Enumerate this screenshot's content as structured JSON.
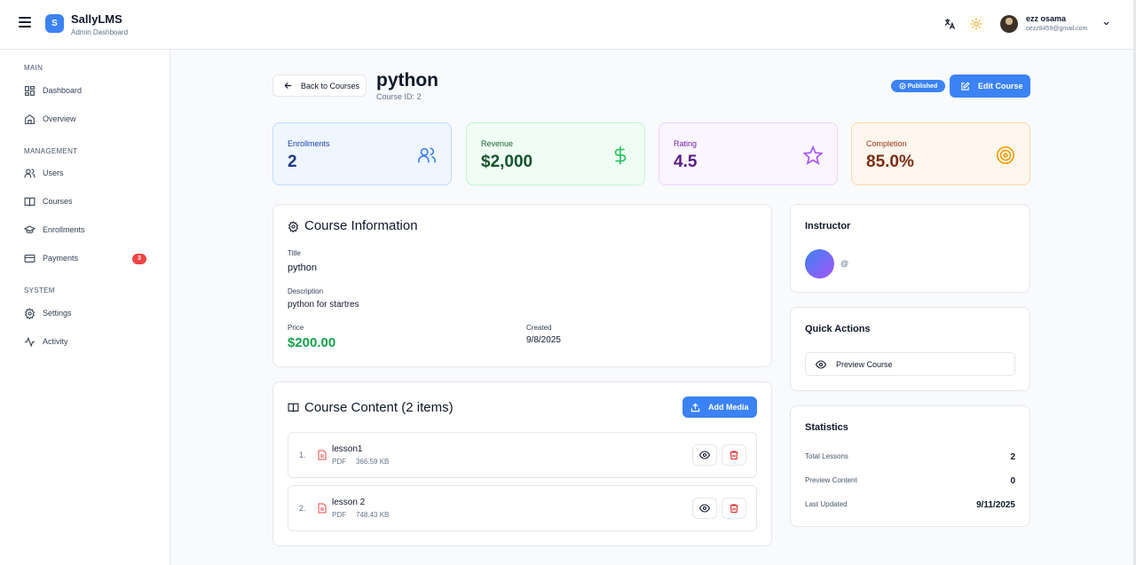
{
  "header": {
    "brand_title": "SallyLMS",
    "brand_sub": "Admin Dashboard",
    "logo_letter": "S",
    "user_name": "ezz osama",
    "user_email": "oezz8459@gmail.com"
  },
  "sidebar": {
    "sections": {
      "main": "MAIN",
      "management": "MANAGEMENT",
      "system": "SYSTEM"
    },
    "items": {
      "dashboard": "Dashboard",
      "overview": "Overview",
      "users": "Users",
      "courses": "Courses",
      "enrollments": "Enrollments",
      "payments": "Payments",
      "settings": "Settings",
      "activity": "Activity"
    },
    "payments_badge": "3"
  },
  "page": {
    "back_label": "Back to Courses",
    "title": "python",
    "course_id": "Course ID: 2",
    "status": "Published",
    "edit_label": "Edit Course"
  },
  "stats": {
    "enrollments": {
      "label": "Enrollments",
      "value": "2"
    },
    "revenue": {
      "label": "Revenue",
      "value": "$2,000"
    },
    "rating": {
      "label": "Rating",
      "value": "4.5"
    },
    "completion": {
      "label": "Completion",
      "value": "85.0%"
    }
  },
  "course_info": {
    "heading": "Course Information",
    "title_label": "Title",
    "title_value": "python",
    "description_label": "Description",
    "description_value": "python for startres",
    "price_label": "Price",
    "price_value": "$200.00",
    "created_label": "Created",
    "created_value": "9/8/2025"
  },
  "content": {
    "heading": "Course Content (2 items)",
    "add_label": "Add Media",
    "lessons": [
      {
        "num": "1.",
        "name": "lesson1",
        "type": "PDF",
        "size": "366.59 KB"
      },
      {
        "num": "2.",
        "name": "lesson 2",
        "type": "PDF",
        "size": "748.43 KB"
      }
    ]
  },
  "instructor": {
    "heading": "Instructor",
    "handle": "@"
  },
  "quick_actions": {
    "heading": "Quick Actions",
    "preview_label": "Preview Course"
  },
  "statistics": {
    "heading": "Statistics",
    "rows": [
      {
        "label": "Total Lessons",
        "value": "2"
      },
      {
        "label": "Preview Content",
        "value": "0"
      },
      {
        "label": "Last Updated",
        "value": "9/11/2025"
      }
    ]
  },
  "colors": {
    "accent": "#3b82f6",
    "badge_red": "#ef4444",
    "price_green": "#16a34a"
  }
}
